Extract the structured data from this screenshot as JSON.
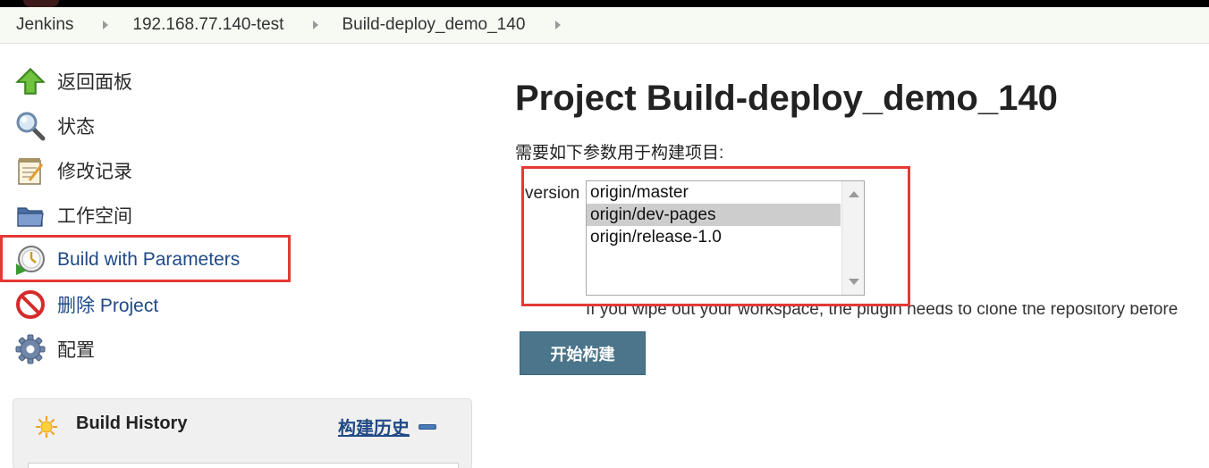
{
  "breadcrumbs": [
    "Jenkins",
    "192.168.77.140-test",
    "Build-deploy_demo_140"
  ],
  "sidebar": {
    "items": [
      {
        "label": "返回面板",
        "icon": "up-arrow-icon"
      },
      {
        "label": "状态",
        "icon": "magnifier-icon"
      },
      {
        "label": "修改记录",
        "icon": "notepad-icon"
      },
      {
        "label": "工作空间",
        "icon": "folder-icon"
      },
      {
        "label": "Build with Parameters",
        "icon": "build-clock-icon"
      },
      {
        "label": "删除 Project",
        "icon": "no-entry-icon"
      },
      {
        "label": "配置",
        "icon": "gear-icon"
      }
    ]
  },
  "build_history": {
    "title": "Build History",
    "link": "构建历史",
    "icon": "sun-icon"
  },
  "main": {
    "title": "Project Build-deploy_demo_140",
    "description": "需要如下参数用于构建项目:",
    "param_name": "version",
    "options": [
      "origin/master",
      "origin/dev-pages",
      "origin/release-1.0"
    ],
    "selected": "origin/dev-pages",
    "help_text": "If you wipe out your workspace, the plugin needs to clone the repository before",
    "build_button": "开始构建"
  },
  "colors": {
    "highlight_box": "#e53935",
    "link": "#204a87",
    "button": "#4b758b",
    "breadcrumb_bg": "#f6faf2"
  }
}
